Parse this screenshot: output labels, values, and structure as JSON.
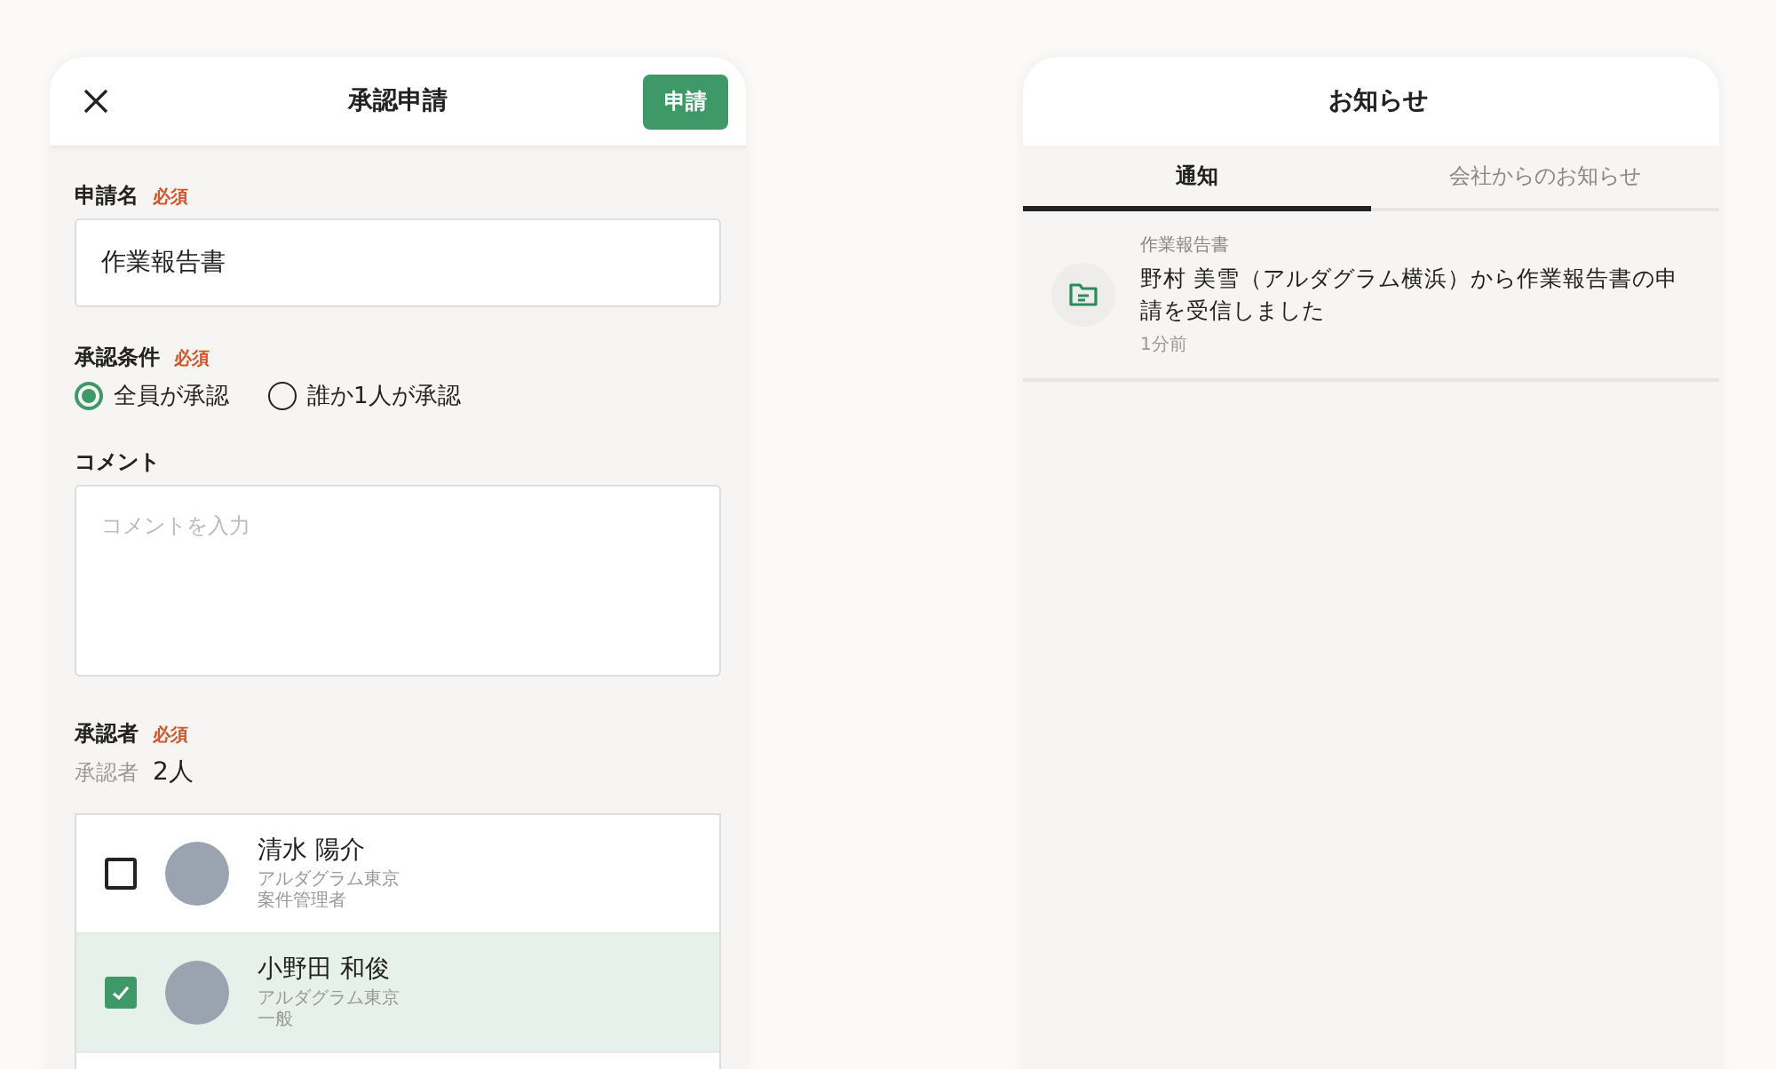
{
  "approval_form": {
    "title": "承認申請",
    "submit_button": "申請",
    "fields": [
      {
        "label": "申請名",
        "required_badge": "必須",
        "kind": "text",
        "value": "作業報告書"
      },
      {
        "label": "承認条件",
        "required_badge": "必須",
        "kind": "radio",
        "options": [
          {
            "label": "全員が承認",
            "selected": true
          },
          {
            "label": "誰か1人が承認",
            "selected": false
          }
        ]
      },
      {
        "label": "コメント",
        "kind": "textarea",
        "placeholder": "コメントを入力"
      },
      {
        "label": "承認者",
        "required_badge": "必須",
        "kind": "approvers",
        "count_label": "承認者",
        "count_value": "2人"
      }
    ],
    "approvers": [
      {
        "name": "清水 陽介",
        "company": "アルダグラム東京",
        "role": "案件管理者",
        "checked": false
      },
      {
        "name": "小野田 和俊",
        "company": "アルダグラム東京",
        "role": "一般",
        "checked": true
      }
    ]
  },
  "notifications": {
    "title": "お知らせ",
    "tabs": [
      {
        "label": "通知",
        "selected": true
      },
      {
        "label": "会社からのお知らせ",
        "selected": false
      }
    ],
    "items": [
      {
        "category": "作業報告書",
        "message": "野村 美雪（アルダグラム横浜）から作業報告書の申請を受信しました",
        "time": "1分前"
      }
    ]
  }
}
